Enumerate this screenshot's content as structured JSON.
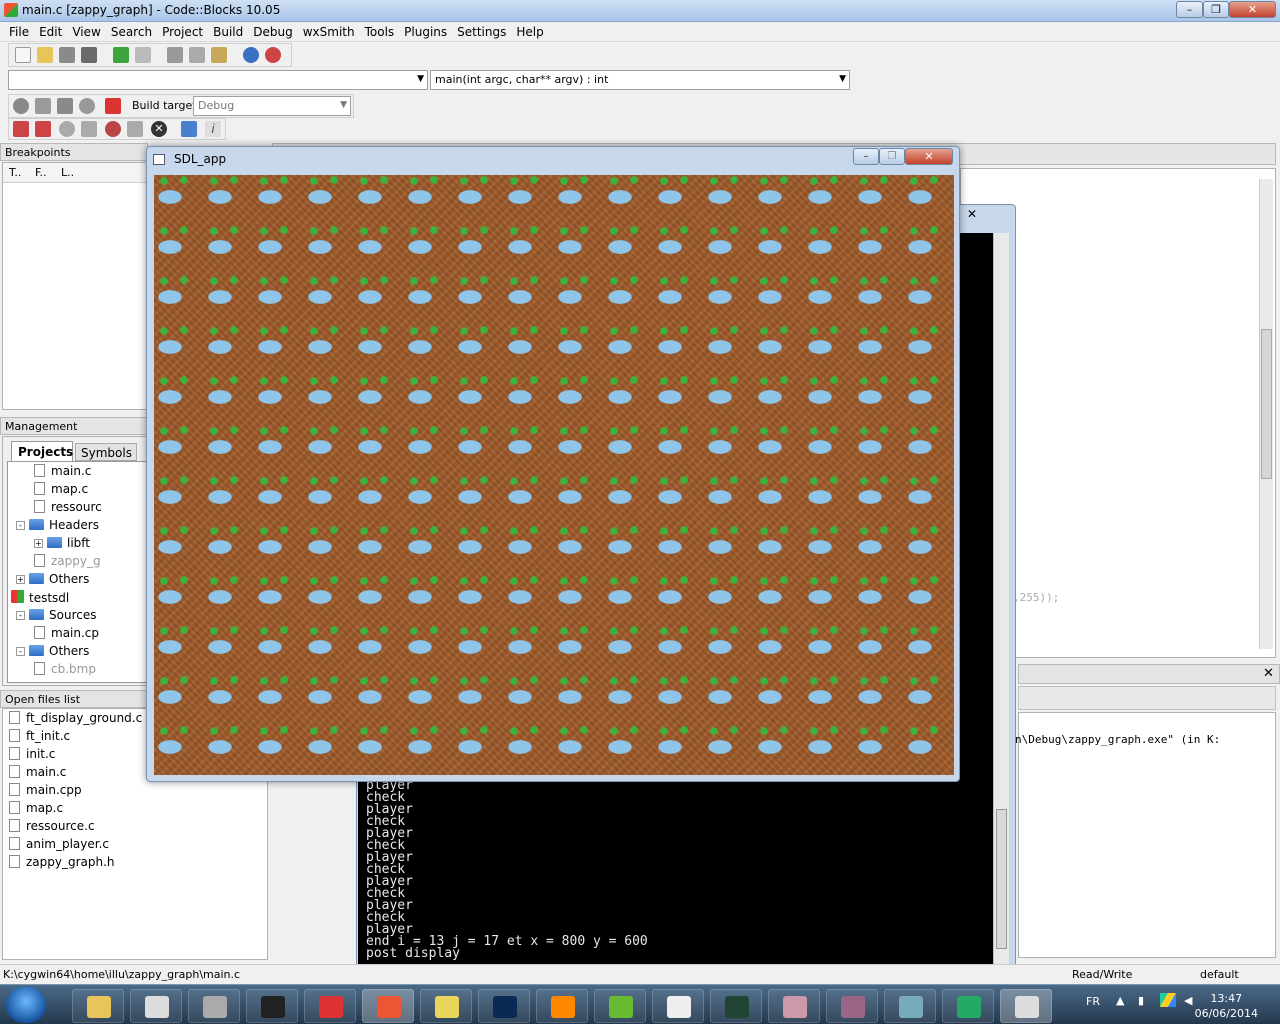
{
  "window": {
    "title": "main.c [zappy_graph] - Code::Blocks 10.05"
  },
  "menu": [
    "File",
    "Edit",
    "View",
    "Search",
    "Project",
    "Build",
    "Debug",
    "wxSmith",
    "Tools",
    "Plugins",
    "Settings",
    "Help"
  ],
  "toolbar": {
    "function_combo": "main(int argc, char** argv) : int",
    "scope_combo": "",
    "build_target_label": "Build target:",
    "build_target_value": "Debug"
  },
  "breakpoints": {
    "title": "Breakpoints",
    "columns": [
      "T..",
      "F..",
      "L.."
    ]
  },
  "management": {
    "title": "Management",
    "tabs": [
      "Projects",
      "Symbols"
    ],
    "tree": [
      {
        "label": "main.c",
        "kind": "file",
        "indent": 3
      },
      {
        "label": "map.c",
        "kind": "file",
        "indent": 3
      },
      {
        "label": "ressourc",
        "kind": "file",
        "indent": 3
      },
      {
        "label": "Headers",
        "kind": "folder",
        "indent": 2,
        "exp": "-"
      },
      {
        "label": "libft",
        "kind": "folder",
        "indent": 3,
        "exp": "+"
      },
      {
        "label": "zappy_g",
        "kind": "file",
        "indent": 3,
        "dim": true
      },
      {
        "label": "Others",
        "kind": "folder",
        "indent": 2,
        "exp": "+"
      },
      {
        "label": "testsdl",
        "kind": "project",
        "indent": 1,
        "exp": "-"
      },
      {
        "label": "Sources",
        "kind": "folder",
        "indent": 2,
        "exp": "-"
      },
      {
        "label": "main.cp",
        "kind": "file",
        "indent": 3
      },
      {
        "label": "Others",
        "kind": "folder",
        "indent": 2,
        "exp": "-"
      },
      {
        "label": "cb.bmp",
        "kind": "file",
        "indent": 3,
        "dim": true
      }
    ]
  },
  "open_files": {
    "title": "Open files list",
    "items": [
      "ft_display_ground.c",
      "ft_init.c",
      "init.c",
      "main.c",
      "main.cpp",
      "map.c",
      "ressource.c",
      "anim_player.c",
      "zappy_graph.h"
    ]
  },
  "editor_fragment": ",255));",
  "build_log_fragment": "n\\Debug\\zappy_graph.exe\"  (in K:",
  "console": {
    "lines": [
      "player",
      "check",
      "player",
      "check",
      "player",
      "check",
      "player",
      "check",
      "player",
      "check",
      "player",
      "check",
      "player",
      "end i = 13 j = 17 et x = 800 y = 600",
      "post display"
    ]
  },
  "sdl": {
    "title": "SDL_app"
  },
  "statusbar": {
    "path": "K:\\cygwin64\\home\\illu\\zappy_graph\\main.c",
    "mode": "Read/Write",
    "profile": "default"
  },
  "taskbar": {
    "lang": "FR",
    "time": "13:47",
    "date": "06/06/2014"
  }
}
